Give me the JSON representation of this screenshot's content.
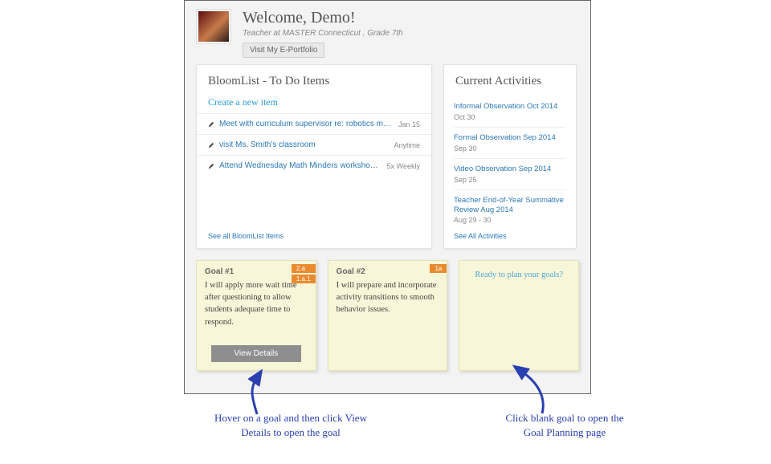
{
  "header": {
    "welcome": "Welcome, Demo!",
    "subtitle": "Teacher at MASTER Connecticut , Grade 7th",
    "eportfolio_btn": "Visit My E-Portfolio"
  },
  "bloom": {
    "title": "BloomList - To Do Items",
    "create_label": "Create a new item",
    "items": [
      {
        "text": "Meet with curriculum supervisor re: robotics module.",
        "meta": "Jan 15"
      },
      {
        "text": "visit Ms. Smith's classroom",
        "meta": "Anytime"
      },
      {
        "text": "Attend Wednesday Math Minders workshops in admini...",
        "meta": "5x Weekly"
      }
    ],
    "see_all": "See all BloomList Items"
  },
  "activities": {
    "title": "Current Activities",
    "items": [
      {
        "title": "Informal Observation Oct 2014",
        "date": "Oct 30"
      },
      {
        "title": "Formal Observation Sep 2014",
        "date": "Sep 30"
      },
      {
        "title": "Video Observation Sep 2014",
        "date": "Sep 25"
      },
      {
        "title": "Teacher End-of-Year Summative Review Aug 2014",
        "date": "Aug 29 - 30"
      }
    ],
    "see_all": "See All Activities"
  },
  "goals": [
    {
      "title": "Goal #1",
      "body": "I will apply more wait time after questioning to allow students adequate time to respond.",
      "tags": [
        "2.a",
        "1.a.1"
      ],
      "view_btn": "View Details"
    },
    {
      "title": "Goal #2",
      "body": "I will prepare and incorporate activity transitions to smooth behavior issues.",
      "tags": [
        "1a"
      ]
    },
    {
      "blank_prompt": "Ready to plan your goals?"
    }
  ],
  "annotations": {
    "left": "Hover on a goal and then click View Details to open the goal",
    "right": "Click blank goal to open the Goal Planning page"
  }
}
